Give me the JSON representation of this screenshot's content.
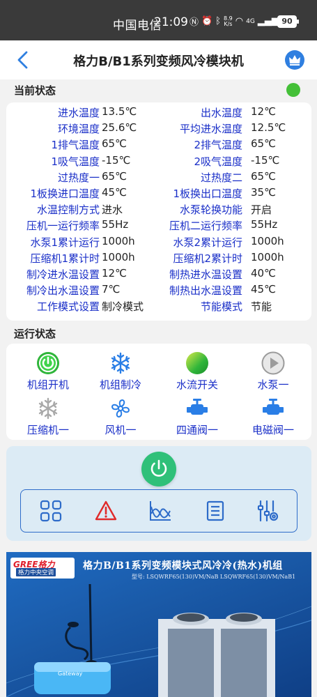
{
  "statusbar": {
    "carrier": "中国电信",
    "time": "21:09",
    "net_speed_top": "8.9",
    "net_speed_bottom": "K/s",
    "network": "4G",
    "battery": "90"
  },
  "header": {
    "title": "格力B/B1系列变频风冷模块机"
  },
  "current_status": {
    "label": "当前状态",
    "indicator_color": "#44c038",
    "rows": [
      {
        "left_label": "进水温度",
        "left_value": "13.5℃",
        "right_label": "出水温度",
        "right_value": "12℃"
      },
      {
        "left_label": "环境温度",
        "left_value": "25.6℃",
        "right_label": "平均进水温度",
        "right_value": "12.5℃"
      },
      {
        "left_label": "1排气温度",
        "left_value": "65℃",
        "right_label": "2排气温度",
        "right_value": "65℃"
      },
      {
        "left_label": "1吸气温度",
        "left_value": "-15℃",
        "right_label": "2吸气温度",
        "right_value": "-15℃"
      },
      {
        "left_label": "过热度一",
        "left_value": "65℃",
        "right_label": "过热度二",
        "right_value": "65℃"
      },
      {
        "left_label": "1板换进口温度",
        "left_value": "45℃",
        "right_label": "1板换出口温度",
        "right_value": "35℃"
      },
      {
        "left_label": "水温控制方式",
        "left_value": "进水",
        "right_label": "水泵轮换功能",
        "right_value": "开启"
      },
      {
        "left_label": "压机一运行频率",
        "left_value": "55Hz",
        "right_label": "压机二运行频率",
        "right_value": "55Hz"
      },
      {
        "left_label": "水泵1累计运行",
        "left_value": "1000h",
        "right_label": "水泵2累计运行",
        "right_value": "1000h"
      },
      {
        "left_label": "压缩机1累计时",
        "left_value": "1000h",
        "right_label": "压缩机2累计时",
        "right_value": "1000h"
      },
      {
        "left_label": "制冷进水温设置",
        "left_value": "12℃",
        "right_label": "制热进水温设置",
        "right_value": "40℃"
      },
      {
        "left_label": "制冷出水温设置",
        "left_value": "7℃",
        "right_label": "制热出水温设置",
        "right_value": "45℃"
      },
      {
        "left_label": "工作模式设置",
        "left_value": "制冷模式",
        "right_label": "节能模式",
        "right_value": "节能"
      }
    ]
  },
  "run_status": {
    "label": "运行状态",
    "items": [
      {
        "label": "机组开机",
        "icon": "power-on-icon"
      },
      {
        "label": "机组制冷",
        "icon": "snowflake-icon"
      },
      {
        "label": "水流开关",
        "icon": "water-flow-icon"
      },
      {
        "label": "水泵一",
        "icon": "play-icon"
      },
      {
        "label": "压缩机一",
        "icon": "snowflake-icon"
      },
      {
        "label": "风机一",
        "icon": "fan-icon"
      },
      {
        "label": "四通阀一",
        "icon": "valve-icon"
      },
      {
        "label": "电磁阀一",
        "icon": "valve-icon"
      }
    ]
  },
  "controls": {
    "power_color": "#2fc079",
    "tools": [
      "grid-icon",
      "alarm-icon",
      "chart-icon",
      "list-icon",
      "settings-sliders-icon"
    ]
  },
  "banner": {
    "brand": "GREE格力",
    "brand_sub": "格力中央空调",
    "title": "格力B/B1系列变频模块式风冷冷(热水)机组",
    "model": "型号: LSQWRF65(130)VM/NaB LSQWRF65(130)VM/NaB1",
    "device_label": "Gateway"
  }
}
